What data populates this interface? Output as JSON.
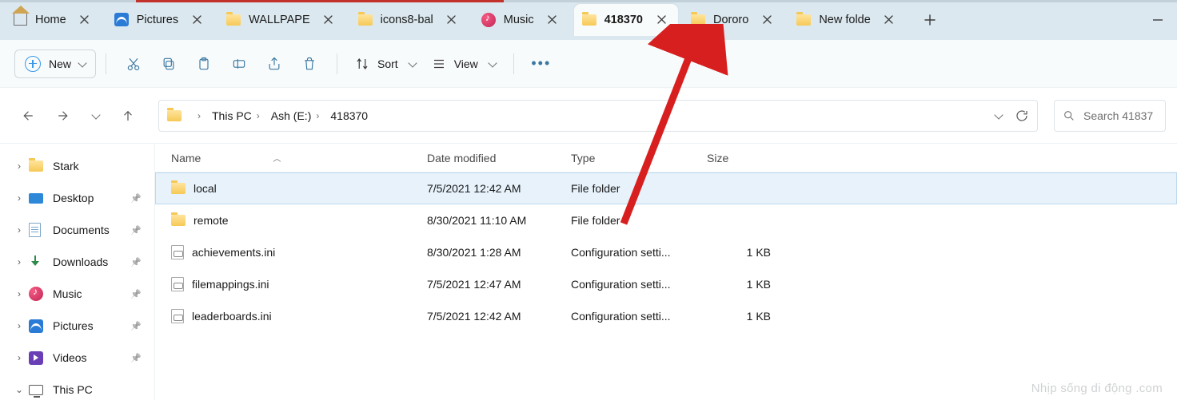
{
  "tabs": [
    {
      "label": "Home",
      "icon": "home"
    },
    {
      "label": "Pictures",
      "icon": "pictures"
    },
    {
      "label": "WALLPAPER",
      "icon": "folder",
      "truncated": "WALLPAPE"
    },
    {
      "label": "icons8-bal",
      "icon": "folder"
    },
    {
      "label": "Music",
      "icon": "music"
    },
    {
      "label": "418370",
      "icon": "folder",
      "active": true
    },
    {
      "label": "Dororo",
      "icon": "folder"
    },
    {
      "label": "New folde",
      "icon": "folder"
    }
  ],
  "toolbar": {
    "new_label": "New",
    "sort_label": "Sort",
    "view_label": "View"
  },
  "breadcrumb": [
    "This PC",
    "Ash (E:)",
    "418370"
  ],
  "search_placeholder": "Search 41837",
  "columns": {
    "name": "Name",
    "modified": "Date modified",
    "type": "Type",
    "size": "Size"
  },
  "files": [
    {
      "name": "local",
      "modified": "7/5/2021 12:42 AM",
      "type": "File folder",
      "size": "",
      "icon": "folder",
      "selected": true
    },
    {
      "name": "remote",
      "modified": "8/30/2021 11:10 AM",
      "type": "File folder",
      "size": "",
      "icon": "folder"
    },
    {
      "name": "achievements.ini",
      "modified": "8/30/2021 1:28 AM",
      "type": "Configuration setti...",
      "size": "1 KB",
      "icon": "ini"
    },
    {
      "name": "filemappings.ini",
      "modified": "7/5/2021 12:47 AM",
      "type": "Configuration setti...",
      "size": "1 KB",
      "icon": "ini"
    },
    {
      "name": "leaderboards.ini",
      "modified": "7/5/2021 12:42 AM",
      "type": "Configuration setti...",
      "size": "1 KB",
      "icon": "ini"
    }
  ],
  "sidebar": [
    {
      "label": "Stark",
      "icon": "folder",
      "twist": "right"
    },
    {
      "label": "Desktop",
      "icon": "desktop",
      "twist": "right",
      "pinned": true
    },
    {
      "label": "Documents",
      "icon": "doc",
      "twist": "right",
      "pinned": true
    },
    {
      "label": "Downloads",
      "icon": "download",
      "twist": "right",
      "pinned": true
    },
    {
      "label": "Music",
      "icon": "music",
      "twist": "right",
      "pinned": true
    },
    {
      "label": "Pictures",
      "icon": "pictures",
      "twist": "right",
      "pinned": true
    },
    {
      "label": "Videos",
      "icon": "videos",
      "twist": "right",
      "pinned": true
    },
    {
      "label": "This PC",
      "icon": "pc",
      "twist": "down"
    }
  ],
  "watermark": "Nhịp sống di động .com"
}
